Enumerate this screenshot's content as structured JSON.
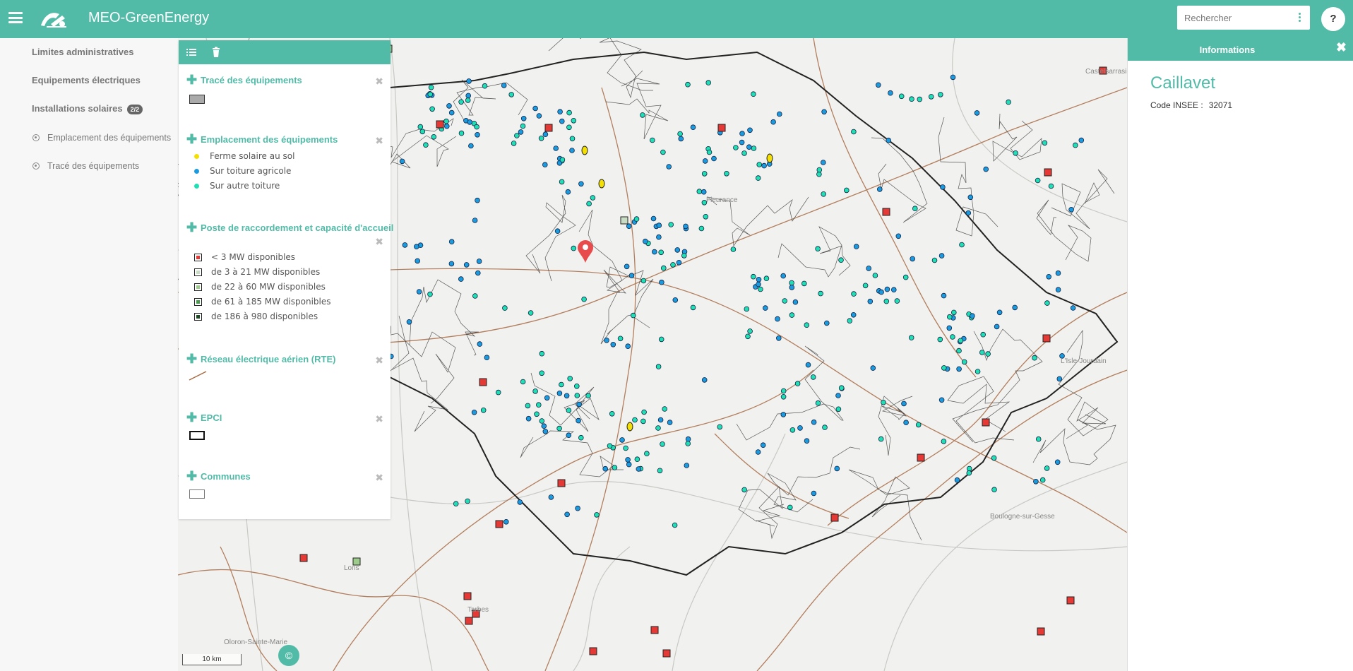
{
  "header": {
    "app_title": "MEO-GreenEnergy",
    "search_placeholder": "Rechercher",
    "help_label": "?"
  },
  "sidebar": {
    "items": [
      {
        "label": "Limites administratives"
      },
      {
        "label": "Equipements électriques"
      },
      {
        "label": "Installations solaires",
        "badge": "2/2"
      }
    ],
    "subitems": [
      {
        "label": "Emplacement des équipements"
      },
      {
        "label": "Tracé des équipements"
      }
    ]
  },
  "legend": {
    "sections": [
      {
        "title": "Tracé des équipements"
      },
      {
        "title": "Emplacement des équipements",
        "entries": [
          {
            "label": "Ferme solaire au sol",
            "color": "#f4e000"
          },
          {
            "label": "Sur toiture agricole",
            "color": "#1a9be0"
          },
          {
            "label": "Sur autre toiture",
            "color": "#1ee0b4"
          }
        ]
      },
      {
        "title": "Poste de raccordement et capacité d'accueil",
        "entries": [
          {
            "label": "< 3 MW disponibles",
            "color": "#e53935"
          },
          {
            "label": "de 3 à 21 MW disponibles",
            "color": "#c8dcc4"
          },
          {
            "label": "de 22 à 60 MW disponibles",
            "color": "#9ccb8c"
          },
          {
            "label": "de 61 à 185 MW disponibles",
            "color": "#4a9a50"
          },
          {
            "label": "de 186 à 980 disponibles",
            "color": "#1c4a22"
          }
        ]
      },
      {
        "title": "Réseau électrique aérien (RTE)"
      },
      {
        "title": "EPCI"
      },
      {
        "title": "Communes"
      }
    ]
  },
  "map": {
    "scale_label": "10 km",
    "copyright_label": "©",
    "place_labels": [
      "Castelsarrasin",
      "Fleurance",
      "Lons",
      "Oloron-Sainte-Marie",
      "L'Isle-Jourdain",
      "Boulogne-sur-Gesse",
      "Tarbes"
    ]
  },
  "info": {
    "panel_title": "Informations",
    "close_label": "✖",
    "commune_name": "Caillavet",
    "insee_label": "Code INSEE :",
    "insee_value": "32071"
  }
}
